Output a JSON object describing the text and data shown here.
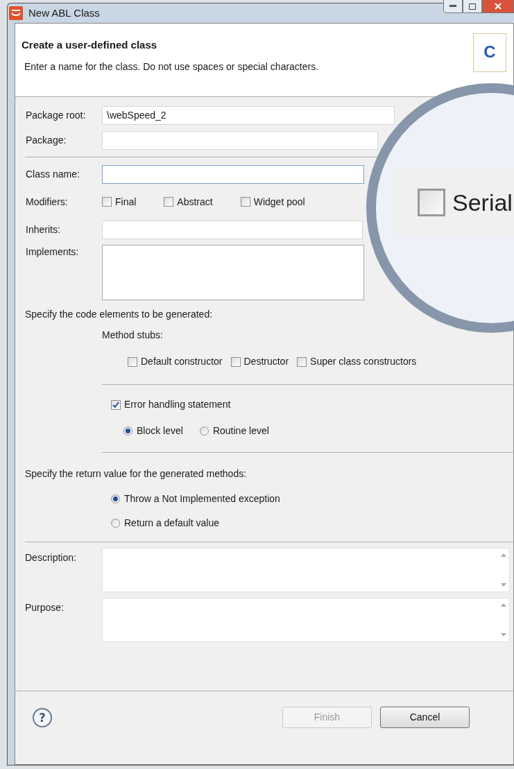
{
  "window": {
    "title": "New ABL Class"
  },
  "header": {
    "title": "Create a user-defined class",
    "description": "Enter a name for the class. Do not use spaces or special characters.",
    "icon_letter": "C"
  },
  "fields": [
    {
      "kind": "text",
      "label": "Package root:",
      "value": "\\webSpeed_2",
      "focused": false
    },
    {
      "kind": "text",
      "label": "Package:",
      "focused": false
    },
    {
      "kind": "separator"
    },
    {
      "kind": "text",
      "label": "Class name:",
      "focused": true
    },
    {
      "kind": "checkboxes",
      "label": "Modifiers:",
      "options": [
        {
          "label": "Final",
          "checked": false
        },
        {
          "label": "Abstract",
          "checked": false
        },
        {
          "label": "Widget pool",
          "checked": false
        }
      ]
    },
    {
      "kind": "text",
      "label": "Inherits:",
      "focused": false
    },
    {
      "kind": "textarea",
      "label": "Implements:"
    }
  ],
  "code_section": {
    "title": "Specify the code elements to be generated:",
    "stubs_label": "Method stubs:",
    "stubs": [
      {
        "label": "Default constructor",
        "checked": false
      },
      {
        "label": "Destructor",
        "checked": false
      },
      {
        "label": "Super class constructors",
        "checked": false
      }
    ],
    "error_handling": {
      "label": "Error handling statement",
      "checked": true
    },
    "error_levels": [
      {
        "label": "Block level",
        "selected": true
      },
      {
        "label": "Routine level",
        "selected": false
      }
    ]
  },
  "return_section": {
    "title": "Specify the return value for the generated methods:",
    "options": [
      {
        "label": "Throw a Not Implemented exception",
        "selected": true
      },
      {
        "label": "Return a default value",
        "selected": false
      }
    ]
  },
  "notes": [
    {
      "label": "Description:"
    },
    {
      "label": "Purpose:"
    }
  ],
  "help": {
    "symbol": "?"
  },
  "buttons": [
    {
      "label": "Finish",
      "disabled": true
    },
    {
      "label": "Cancel",
      "disabled": false
    }
  ],
  "magnifier": {
    "label": "Serial",
    "checked": false
  }
}
